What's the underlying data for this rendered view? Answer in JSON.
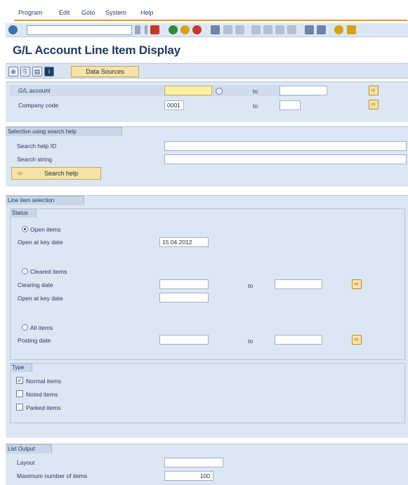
{
  "menu": {
    "items": [
      "Program",
      "Edit",
      "Goto",
      "System",
      "Help"
    ]
  },
  "title": "G/L Account Line Item Display",
  "app_toolbar": {
    "data_sources_label": "Data Sources"
  },
  "top_selection": {
    "gl_account": {
      "label": "G/L account",
      "value": "",
      "to_label": "to",
      "to_value": ""
    },
    "company_code": {
      "label": "Company code",
      "value": "0001",
      "to_label": "to",
      "to_value": ""
    }
  },
  "search_help_group": {
    "header": "Selection using search help",
    "search_help_id_label": "Search help ID",
    "search_string_label": "Search string",
    "search_help_button": "Search help"
  },
  "line_item_group": {
    "header": "Line item selection",
    "status_header": "Status",
    "open_items_label": "Open items",
    "open_at_key_date_label": "Open at key date",
    "open_at_key_date_value": "15.04.2012",
    "cleared_items_label": "Cleared items",
    "clearing_date_label": "Clearing date",
    "cleared_open_at_key_date_label": "Open at key date",
    "all_items_label": "All items",
    "posting_date_label": "Posting date",
    "to_label": "to",
    "type_header": "Type",
    "normal_items_label": "Normal items",
    "noted_items_label": "Noted items",
    "parked_items_label": "Parked items"
  },
  "list_output_group": {
    "header": "List Output",
    "layout_label": "Layout",
    "max_items_label": "Maximum number of items",
    "max_items_value": "100"
  },
  "colors": {
    "accent_orange": "#e89a2e",
    "panel_blue": "#dde7f3",
    "title_blue": "#1f3a66",
    "button_yellow": "#f6e3a8"
  }
}
